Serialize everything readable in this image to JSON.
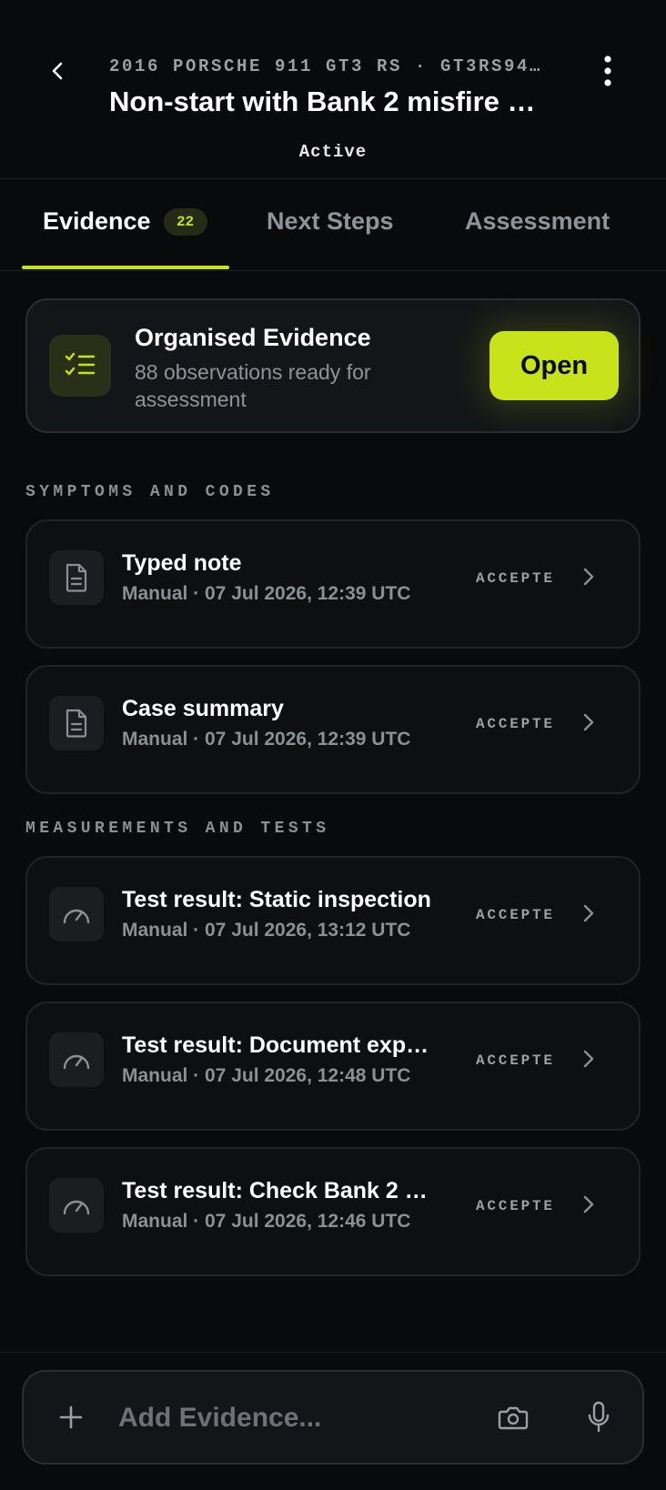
{
  "header": {
    "vehicle": "2016 PORSCHE 911 GT3 RS · GT3RS94…",
    "title": "Non-start with Bank 2 misfire …",
    "status": "Active",
    "icons": {
      "back": "chevron-left-icon",
      "more": "more-vertical-icon"
    }
  },
  "tabs": [
    {
      "label": "Evidence",
      "badge": "22",
      "active": true
    },
    {
      "label": "Next Steps",
      "active": false
    },
    {
      "label": "Assessment",
      "active": false
    }
  ],
  "organised": {
    "title": "Organised Evidence",
    "subtitle": "88 observations ready for assessment",
    "button": "Open",
    "icon": "checklist-icon"
  },
  "sections": [
    {
      "heading": "SYMPTOMS AND CODES",
      "items": [
        {
          "title": "Typed note",
          "meta": "Manual · 07 Jul 2026, 12:39 UTC",
          "status": "ACCEPTE",
          "icon": "document-icon"
        },
        {
          "title": "Case summary",
          "meta": "Manual · 07 Jul 2026, 12:39 UTC",
          "status": "ACCEPTE",
          "icon": "document-icon"
        }
      ]
    },
    {
      "heading": "MEASUREMENTS AND TESTS",
      "items": [
        {
          "title": "Test result: Static inspection",
          "meta": "Manual · 07 Jul 2026, 13:12 UTC",
          "status": "ACCEPTE",
          "icon": "gauge-icon"
        },
        {
          "title": "Test result: Document exp…",
          "meta": "Manual · 07 Jul 2026, 12:48 UTC",
          "status": "ACCEPTE",
          "icon": "gauge-icon"
        },
        {
          "title": "Test result: Check Bank 2 …",
          "meta": "Manual · 07 Jul 2026, 12:46 UTC",
          "status": "ACCEPTE",
          "icon": "gauge-icon"
        }
      ]
    }
  ],
  "composer": {
    "placeholder": "Add Evidence...",
    "icons": {
      "add": "plus-icon",
      "camera": "camera-icon",
      "mic": "microphone-icon"
    }
  },
  "colors": {
    "accent": "#c9e31a",
    "background": "#090a0b",
    "card": "#131618",
    "muted": "#8e9498"
  }
}
